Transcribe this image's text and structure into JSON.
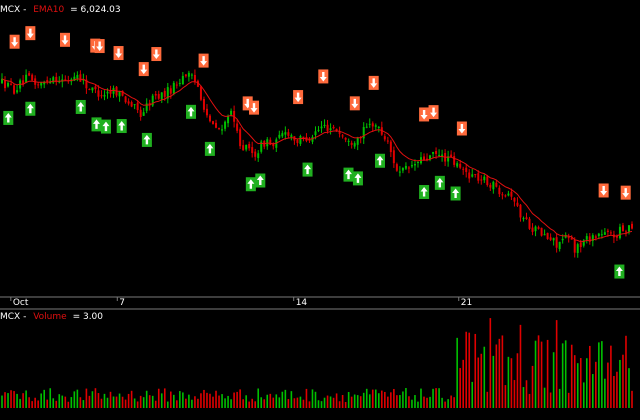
{
  "price_panel": {
    "symbol_label": "MCX -",
    "ema_label": "EMA10",
    "ema_value": "= 6,024.03"
  },
  "volume_panel": {
    "symbol_label": "MCX -",
    "volume_label": "Volume",
    "volume_value": "= 3.00"
  },
  "x_axis": {
    "ticks": [
      "Oct",
      "7",
      "14",
      "21"
    ]
  },
  "colors": {
    "background": "#000000",
    "up": "#00c000",
    "down": "#e00000",
    "ema": "#e01010",
    "sell_arrow_bg": "#ff6a3c",
    "buy_arrow_bg": "#20b020",
    "panel_border": "#7a7a7a",
    "text": "#ffffff"
  },
  "chart_data": {
    "type": "candlestick",
    "series": [
      {
        "name": "EMA10"
      },
      {
        "name": "Volume"
      }
    ],
    "price_path": [
      [
        0.0,
        6098
      ],
      [
        0.02,
        6094
      ],
      [
        0.04,
        6100
      ],
      [
        0.06,
        6096
      ],
      [
        0.08,
        6101
      ],
      [
        0.1,
        6098
      ],
      [
        0.12,
        6102
      ],
      [
        0.14,
        6094
      ],
      [
        0.16,
        6092
      ],
      [
        0.18,
        6094
      ],
      [
        0.2,
        6088
      ],
      [
        0.22,
        6081
      ],
      [
        0.24,
        6090
      ],
      [
        0.26,
        6092
      ],
      [
        0.28,
        6098
      ],
      [
        0.29,
        6103
      ],
      [
        0.31,
        6097
      ],
      [
        0.33,
        6076
      ],
      [
        0.35,
        6072
      ],
      [
        0.36,
        6084
      ],
      [
        0.38,
        6065
      ],
      [
        0.4,
        6060
      ],
      [
        0.42,
        6068
      ],
      [
        0.43,
        6064
      ],
      [
        0.45,
        6073
      ],
      [
        0.47,
        6067
      ],
      [
        0.49,
        6070
      ],
      [
        0.51,
        6075
      ],
      [
        0.53,
        6074
      ],
      [
        0.55,
        6066
      ],
      [
        0.57,
        6071
      ],
      [
        0.59,
        6077
      ],
      [
        0.61,
        6068
      ],
      [
        0.63,
        6050
      ],
      [
        0.65,
        6054
      ],
      [
        0.67,
        6058
      ],
      [
        0.69,
        6060
      ],
      [
        0.71,
        6058
      ],
      [
        0.73,
        6052
      ],
      [
        0.75,
        6049
      ],
      [
        0.77,
        6046
      ],
      [
        0.79,
        6042
      ],
      [
        0.81,
        6040
      ],
      [
        0.82,
        6030
      ],
      [
        0.84,
        6023
      ],
      [
        0.86,
        6018
      ],
      [
        0.88,
        6014
      ],
      [
        0.9,
        6017
      ],
      [
        0.91,
        6011
      ],
      [
        0.93,
        6017
      ],
      [
        0.95,
        6019
      ],
      [
        0.97,
        6018
      ],
      [
        1.0,
        6024
      ]
    ],
    "volume_surge_start": 0.72,
    "signals": {
      "sell": [
        0.02,
        0.045,
        0.1,
        0.148,
        0.155,
        0.185,
        0.225,
        0.245,
        0.32,
        0.39,
        0.4,
        0.47,
        0.51,
        0.56,
        0.59,
        0.67,
        0.685,
        0.73,
        0.955,
        0.99
      ],
      "buy": [
        0.01,
        0.045,
        0.125,
        0.15,
        0.165,
        0.19,
        0.23,
        0.3,
        0.33,
        0.395,
        0.41,
        0.485,
        0.55,
        0.565,
        0.6,
        0.67,
        0.695,
        0.72,
        0.98
      ]
    }
  }
}
